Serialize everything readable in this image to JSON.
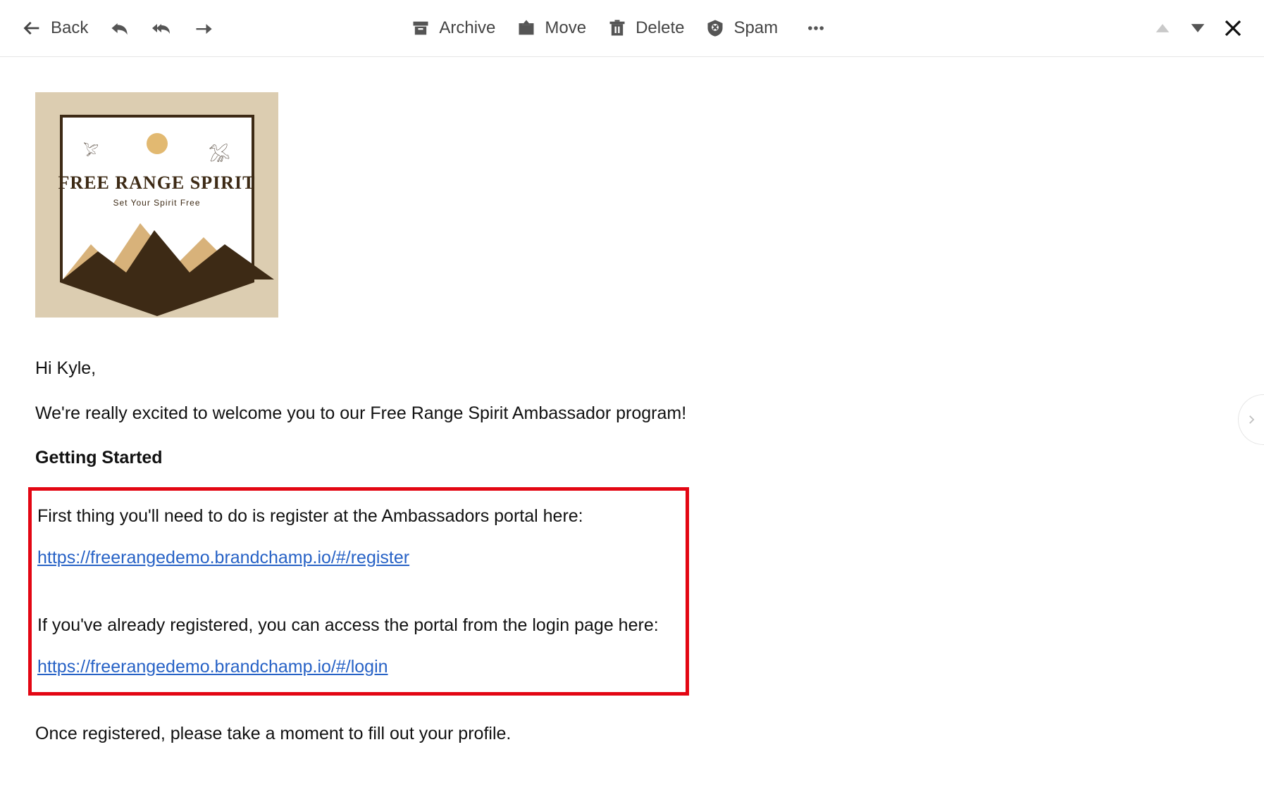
{
  "toolbar": {
    "back_label": "Back",
    "archive_label": "Archive",
    "move_label": "Move",
    "delete_label": "Delete",
    "spam_label": "Spam"
  },
  "logo": {
    "brand": "FREE RANGE SPIRIT",
    "tagline": "Set Your Spirit Free"
  },
  "email": {
    "greeting": "Hi Kyle,",
    "welcome_line": "We're really excited to welcome you to our Free Range Spirit Ambassador program!",
    "section_heading": "Getting Started",
    "register_intro": "First thing you'll need to do is register at the Ambassadors portal here:",
    "register_link": "https://freerangedemo.brandchamp.io/#/register",
    "login_intro": "If you've already registered, you can access the portal from the login page here:",
    "login_link": "https://freerangedemo.brandchamp.io/#/login ",
    "profile_line": "Once registered, please take a moment to fill out your profile."
  }
}
